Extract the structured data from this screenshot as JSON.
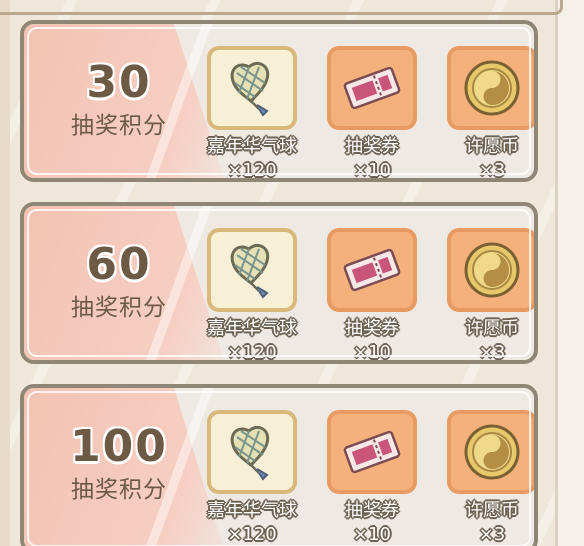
{
  "tiers": [
    {
      "score": "30",
      "label": "抽奖积分",
      "rewards": [
        {
          "name": "嘉年华气球",
          "qty": "×120",
          "icon": "balloon-icon",
          "frame": "cream"
        },
        {
          "name": "抽奖券",
          "qty": "×10",
          "icon": "ticket-icon",
          "frame": "orange"
        },
        {
          "name": "许愿币",
          "qty": "×3",
          "icon": "wish-coin-icon",
          "frame": "orange"
        }
      ]
    },
    {
      "score": "60",
      "label": "抽奖积分",
      "rewards": [
        {
          "name": "嘉年华气球",
          "qty": "×120",
          "icon": "balloon-icon",
          "frame": "cream"
        },
        {
          "name": "抽奖券",
          "qty": "×10",
          "icon": "ticket-icon",
          "frame": "orange"
        },
        {
          "name": "许愿币",
          "qty": "×3",
          "icon": "wish-coin-icon",
          "frame": "orange"
        }
      ]
    },
    {
      "score": "100",
      "label": "抽奖积分",
      "rewards": [
        {
          "name": "嘉年华气球",
          "qty": "×120",
          "icon": "balloon-icon",
          "frame": "cream"
        },
        {
          "name": "抽奖券",
          "qty": "×10",
          "icon": "ticket-icon",
          "frame": "orange"
        },
        {
          "name": "许愿币",
          "qty": "×3",
          "icon": "wish-coin-icon",
          "frame": "orange"
        }
      ]
    }
  ],
  "colors": {
    "card_border": "#8f8676",
    "score_text": "#6c5a45",
    "pink_band": "#f3c2b3",
    "cream_frame": "#d9b979",
    "orange_frame": "#f4b17c"
  }
}
